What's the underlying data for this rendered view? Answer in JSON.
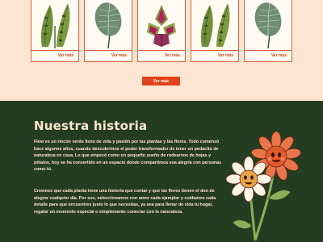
{
  "products": [
    {
      "link": "Ver más",
      "image": "calathea-lancifolia"
    },
    {
      "link": "Ver más",
      "image": "calathea-orbifolia"
    },
    {
      "link": "Ver más",
      "image": "coleus-plant"
    },
    {
      "link": "Ver más",
      "image": "calathea-lancifolia"
    },
    {
      "link": "Ver más",
      "image": "calathea-orbifolia"
    }
  ],
  "actions": {
    "view_more": "Ver más"
  },
  "history": {
    "title": "Nuestra historia",
    "paragraph1": "Flow es un rincón verde lleno de vida y pasión por las plantas y las flores. Todo comenzó hace algunos años, cuando descubrimos el poder transformador de tener un pedacito de naturaleza en casa. Lo que empezó como un pequeño sueño de rodearnos de hojas y pétalos, hoy se ha convertido en un espacio donde compartimos esa alegría con personas como tú.",
    "paragraph2": "Creemos que cada planta tiene una historia que contar y que las flores tienen el don de alegrar cualquier día. Por eso, seleccionamos con amor cada ejemplar y cuidamos cada detalle para que encuentres justo lo que necesitas, ya sea para llenar de vida tu hogar, regalar un momento especial o simplemente conectar con la naturaleza."
  },
  "colors": {
    "cream": "#fde6d1",
    "accent": "#e0431b",
    "dark_green": "#243d22"
  }
}
